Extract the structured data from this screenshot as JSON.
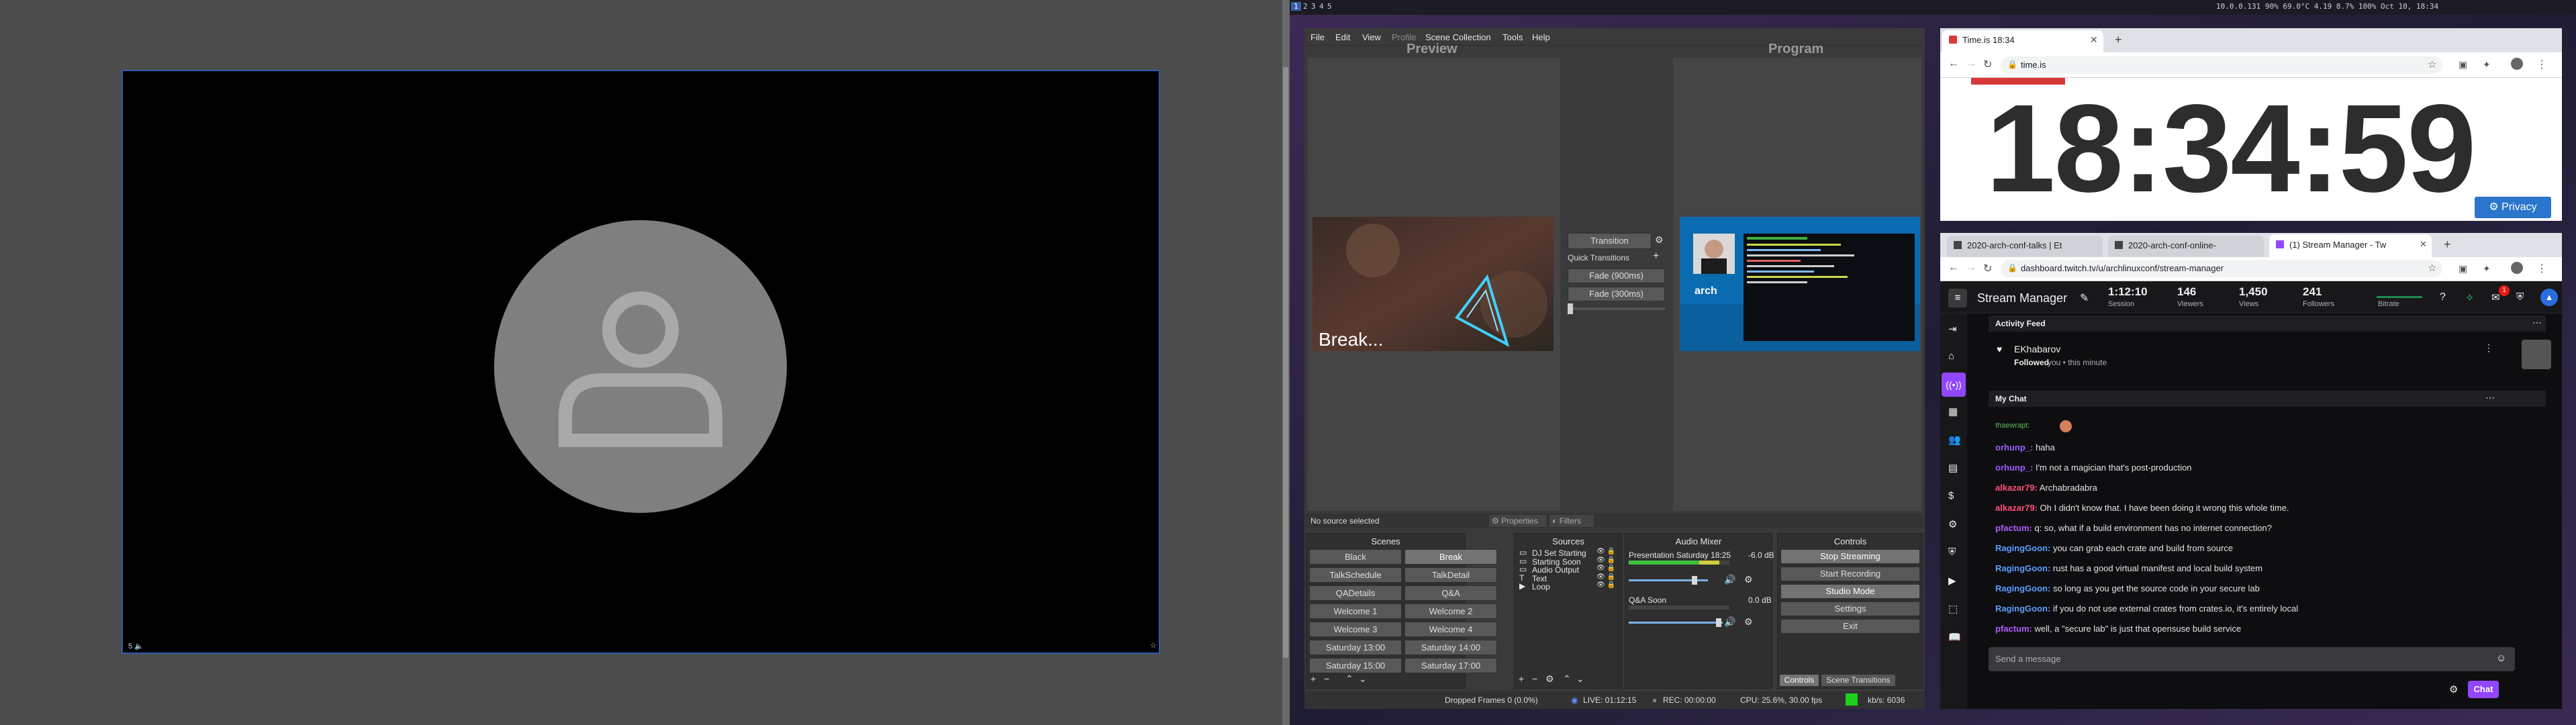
{
  "topbar": {
    "workspaces": [
      "1",
      "2",
      "3",
      "4",
      "5"
    ],
    "status_text": "10.0.0.131 90% 69.0°C 4.19 8.7% 100% Oct 10, 18:34"
  },
  "left_pane": {
    "overlay_left": "5 🔈",
    "overlay_right": "☆"
  },
  "obs": {
    "menu": [
      "File",
      "Edit",
      "View",
      "Profile",
      "Scene Collection",
      "Tools",
      "Help"
    ],
    "preview_label": "Preview",
    "program_label": "Program",
    "preview_overlay_text": "Break...",
    "transition_button": "Transition",
    "quick_transitions_label": "Quick Transitions",
    "fade_options": [
      "Fade (900ms)",
      "Fade (300ms)"
    ],
    "no_source_label": "No source selected",
    "properties_button": "Properties",
    "filters_button": "Filters",
    "scenes_title": "Scenes",
    "scenes": [
      [
        "Black",
        "Break"
      ],
      [
        "TalkSchedule",
        "TalkDetail"
      ],
      [
        "QADetails",
        "Q&A"
      ],
      [
        "Welcome 1",
        "Welcome 2"
      ],
      [
        "Welcome 3",
        "Welcome 4"
      ],
      [
        "Saturday 13:00",
        "Saturday 14:00"
      ],
      [
        "Saturday 15:00",
        "Saturday 17:00"
      ]
    ],
    "selected_scene": "Break",
    "sources_title": "Sources",
    "sources": [
      "DJ Set Starting",
      "Starting Soon",
      "Audio Output",
      "Text",
      "Loop"
    ],
    "mixer_title": "Audio Mixer",
    "mixer": [
      {
        "name": "Presentation Saturday 18:25",
        "db": "-6.0 dB"
      },
      {
        "name": "Q&A Soon",
        "db": "0.0 dB"
      }
    ],
    "controls_title": "Controls",
    "controls": [
      "Stop Streaming",
      "Start Recording",
      "Studio Mode",
      "Settings",
      "Exit"
    ],
    "dock_tabs": [
      "Controls",
      "Scene Transitions"
    ],
    "status": {
      "dropped": "Dropped Frames 0 (0.0%)",
      "live": "LIVE: 01:12:15",
      "rec": "REC: 00:00:00",
      "cpu": "CPU: 25.6%, 30.00 fps",
      "kbps": "kb/s: 6036"
    }
  },
  "browser_top": {
    "tab_title": "Time.is 18:34",
    "url": "time.is",
    "time": "18:34:59",
    "privacy_button": "Privacy"
  },
  "browser_bottom": {
    "tabs": [
      "2020-arch-conf-talks | Et",
      "2020-arch-conf-online-",
      "(1) Stream Manager - Tw"
    ],
    "url": "dashboard.twitch.tv/u/archlinuxconf/stream-manager",
    "header_title": "Stream Manager",
    "stats": [
      {
        "value": "1:12:10",
        "label": "Session"
      },
      {
        "value": "146",
        "label": "Viewers"
      },
      {
        "value": "1,450",
        "label": "Views"
      },
      {
        "value": "241",
        "label": "Followers"
      },
      {
        "value": "",
        "label": "Bitrate"
      }
    ],
    "notification_count": "1",
    "activity_title": "Activity Feed",
    "activity_user": "EKhabarov",
    "activity_action": "Followed",
    "activity_rest": "you • this minute",
    "chat_title": "My Chat",
    "chat_first_user": "thaewrapt:",
    "chat_messages": [
      {
        "user": "orhunp_:",
        "text": "haha",
        "color": "#9c5cff"
      },
      {
        "user": "orhunp_:",
        "text": "I'm not a magician that's post-production",
        "color": "#9c5cff"
      },
      {
        "user": "alkazar79:",
        "text": "Archabradabra",
        "color": "#ff4f7b"
      },
      {
        "user": "alkazar79:",
        "text": "Oh I didn't know that. I have been doing it wrong this whole time.",
        "color": "#ff4f7b"
      },
      {
        "user": "pfactum:",
        "text": "q: so, what if a build environment has no internet connection?",
        "color": "#b05cff"
      },
      {
        "user": "RagingGoon:",
        "text": "you can grab each crate and build from source",
        "color": "#5c9cff"
      },
      {
        "user": "RagingGoon:",
        "text": "rust has a good virtual manifest and local build system",
        "color": "#5c9cff"
      },
      {
        "user": "RagingGoon:",
        "text": "so long as you get the source code in your secure lab",
        "color": "#5c9cff"
      },
      {
        "user": "RagingGoon:",
        "text": "if you do not use external crates from crates.io, it's entirely local",
        "color": "#5c9cff"
      },
      {
        "user": "pfactum:",
        "text": "well, a \"secure lab\" is just that opensuse build service",
        "color": "#b05cff"
      }
    ],
    "chat_placeholder": "Send a message",
    "chat_button": "Chat"
  }
}
